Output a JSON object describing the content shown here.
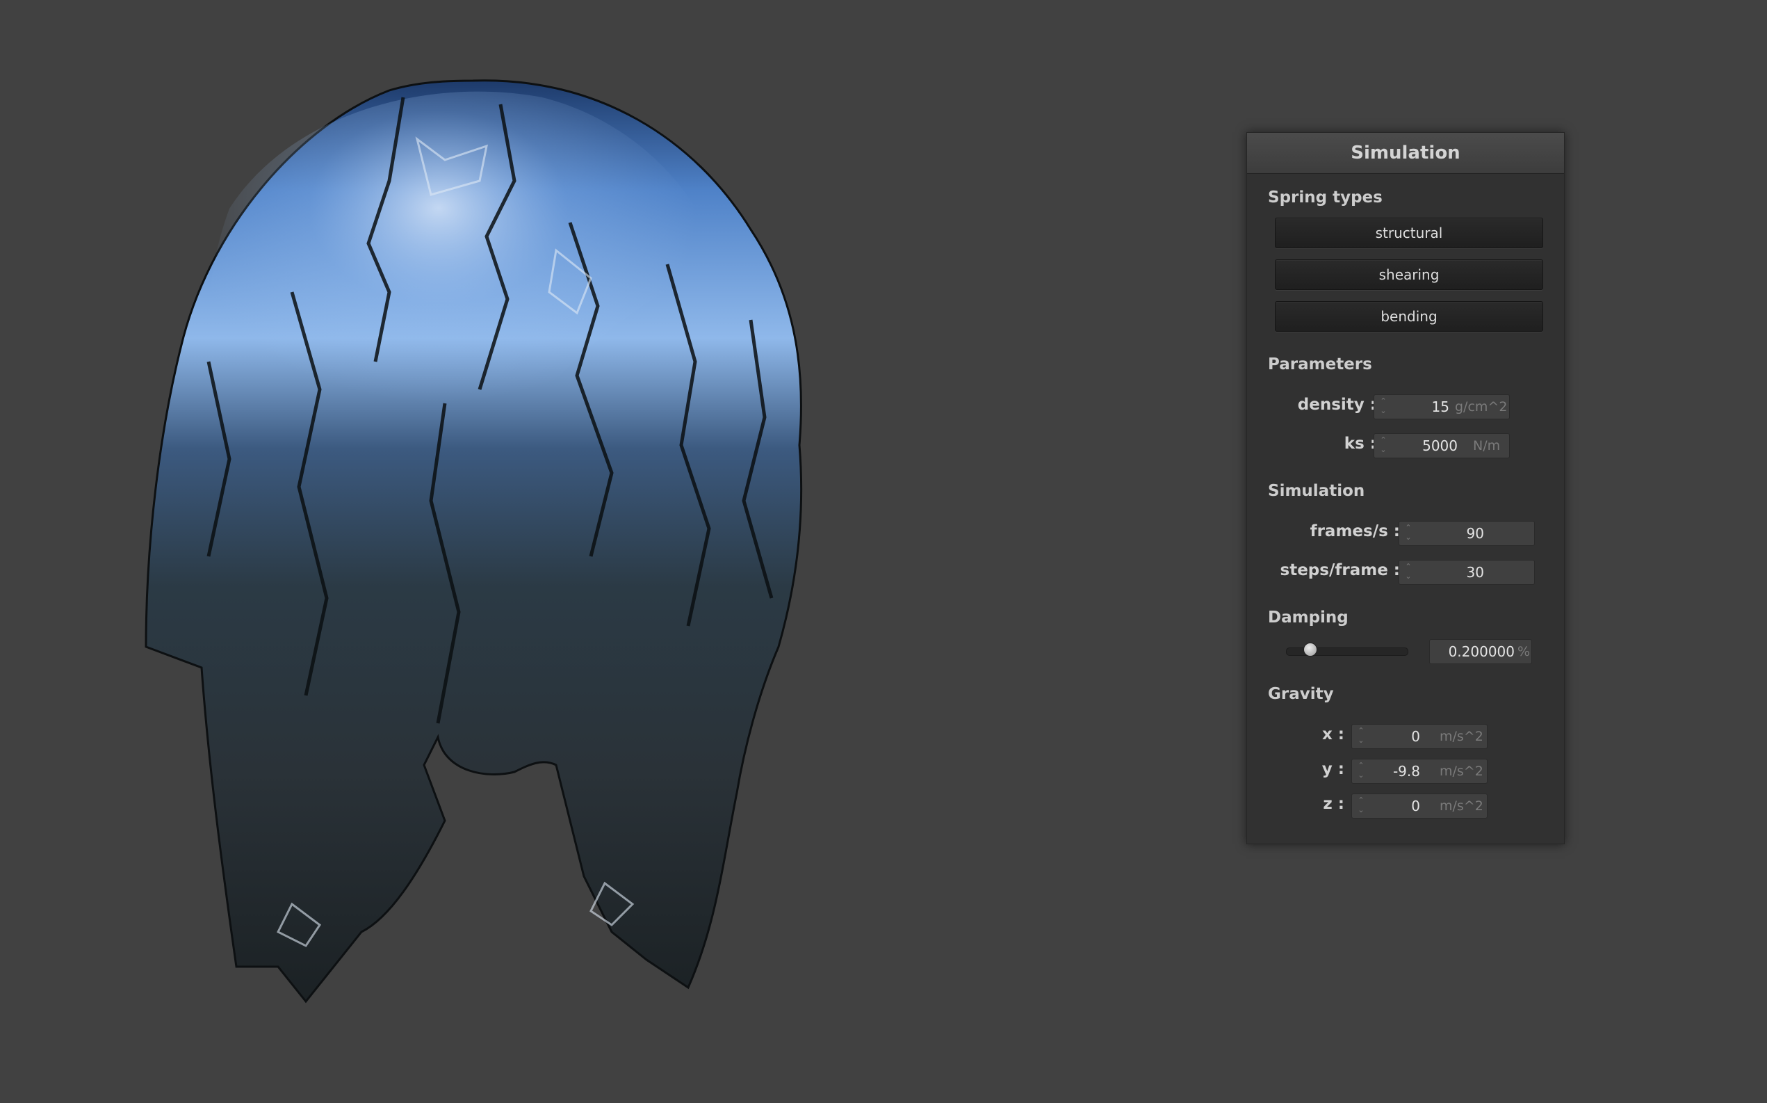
{
  "panel": {
    "title": "Simulation",
    "spring_types": {
      "label": "Spring types",
      "buttons": [
        "structural",
        "shearing",
        "bending"
      ]
    },
    "parameters": {
      "label": "Parameters",
      "density": {
        "label": "density :",
        "value": "15",
        "unit": "g/cm^2"
      },
      "ks": {
        "label": "ks :",
        "value": "5000",
        "unit": "N/m"
      }
    },
    "simulation": {
      "label": "Simulation",
      "fps": {
        "label": "frames/s :",
        "value": "90"
      },
      "steps": {
        "label": "steps/frame :",
        "value": "30"
      }
    },
    "damping": {
      "label": "Damping",
      "value": "0.200000",
      "unit": "%",
      "slider_fraction": 0.2
    },
    "gravity": {
      "label": "Gravity",
      "x": {
        "label": "x :",
        "value": "0",
        "unit": "m/s^2"
      },
      "y": {
        "label": "y :",
        "value": "-9.8",
        "unit": "m/s^2"
      },
      "z": {
        "label": "z :",
        "value": "0",
        "unit": "m/s^2"
      }
    }
  },
  "colors": {
    "background": "#414141",
    "panel": "#313131",
    "cloth_highlight": "#8fb8ea",
    "cloth_shadow": "#1a1f22"
  }
}
